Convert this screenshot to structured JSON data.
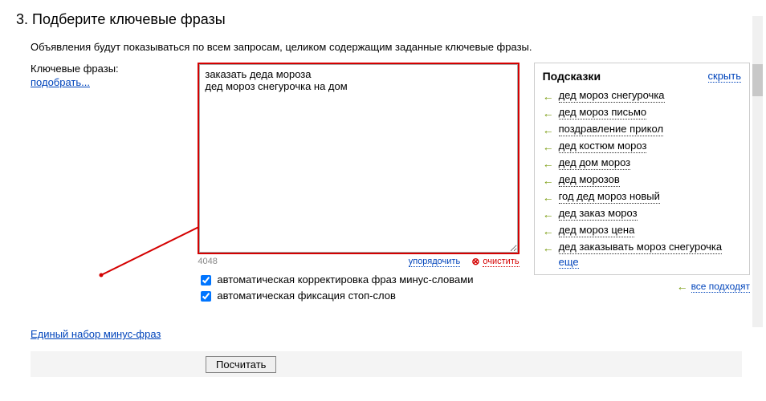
{
  "step": {
    "number": "3.",
    "title": "Подберите ключевые фразы",
    "description": "Объявления будут показываться по всем запросам, целиком содержащим заданные ключевые фразы."
  },
  "left": {
    "label": "Ключевые фразы:",
    "pick_link": "подобрать..."
  },
  "textarea": {
    "value": "заказать деда мороза\nдед мороз снегурочка на дом",
    "counter": "4048",
    "sort_link": "упорядочить",
    "clear_link": "очистить"
  },
  "checkboxes": {
    "auto_correct": "автоматическая корректировка фраз минус-словами",
    "auto_stop": "автоматическая фиксация стоп-слов"
  },
  "hints": {
    "title": "Подсказки",
    "hide": "скрыть",
    "items": [
      "дед мороз снегурочка",
      "дед мороз письмо",
      "поздравление прикол",
      "дед костюм мороз",
      "дед дом мороз",
      "дед морозов",
      "год дед мороз новый",
      "дед заказ мороз",
      "дед мороз цена",
      "дед заказывать мороз снегурочка"
    ],
    "more": "еще",
    "all_fit": "все подходят"
  },
  "bottom_link": "Единый набор минус-фраз",
  "footer": {
    "calculate": "Посчитать"
  }
}
